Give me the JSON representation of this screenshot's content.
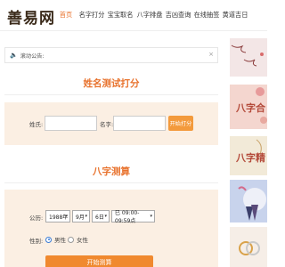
{
  "header": {
    "logo": "善易网",
    "nav": [
      "首页",
      "名字打分",
      "宝宝取名",
      "八字排盘",
      "吉凶查询",
      "在线抽签",
      "黄道吉日"
    ],
    "active_index": 0
  },
  "notice": {
    "label": "滚动公告:",
    "close": "×"
  },
  "name_test": {
    "title": "姓名测试打分",
    "surname_label": "姓氏:",
    "name_label": "名字:",
    "surname_value": "",
    "name_value": "",
    "button": "开始打分"
  },
  "bazi": {
    "title": "八字测算",
    "date_label": "公历:",
    "year": "1988年",
    "month": "9月",
    "day": "6日",
    "hour": "巳 09:00-09:59点",
    "gender_label": "性别:",
    "male": "男性",
    "female": "女性",
    "gender_selected": "male",
    "button": "开始测算"
  },
  "sidebar": {
    "banner2_text": "八字合",
    "banner3_text": "八字精"
  },
  "colors": {
    "accent": "#e8732e",
    "card_bg": "#fbefe3",
    "button": "#f39a3c"
  }
}
